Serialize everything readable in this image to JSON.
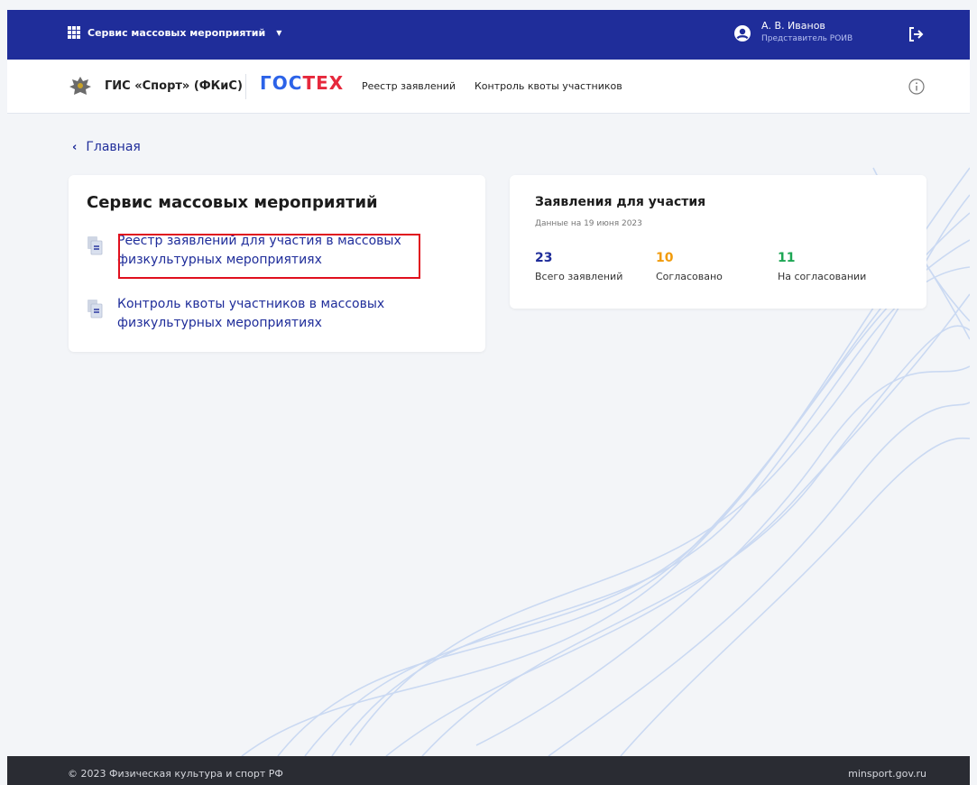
{
  "topbar": {
    "service_title": "Сервис массовых мероприятий",
    "user_name": "А. В. Иванов",
    "user_role": "Представитель РОИВ"
  },
  "navbar": {
    "gis_title": "ГИС «Спорт» (ФКиС)",
    "gostech_part1": "ГОС",
    "gostech_part2": "ТЕХ",
    "links": [
      "Реестр заявлений",
      "Контроль квоты участников"
    ]
  },
  "breadcrumb": {
    "label": "Главная"
  },
  "service_card": {
    "title": "Сервис массовых мероприятий",
    "items": [
      {
        "label": "Реестр заявлений для участия в массовых физкультурных мероприятиях"
      },
      {
        "label": "Контроль квоты участников в массовых физкультурных мероприятиях"
      }
    ]
  },
  "stats_card": {
    "title": "Заявления для участия",
    "subtitle": "Данные на 19 июня 2023",
    "stats": [
      {
        "value": "23",
        "label": "Всего заявлений",
        "color": "#1f2d9a"
      },
      {
        "value": "10",
        "label": "Согласовано",
        "color": "#f19b0c"
      },
      {
        "value": "11",
        "label": "На согласовании",
        "color": "#1da654"
      }
    ]
  },
  "footer": {
    "copyright": "© 2023 Физическая культура и спорт РФ",
    "site": "minsport.gov.ru"
  },
  "colors": {
    "primary": "#1f2d9a",
    "highlight_border": "#e0101e",
    "footer_bg": "#2a2c33"
  }
}
